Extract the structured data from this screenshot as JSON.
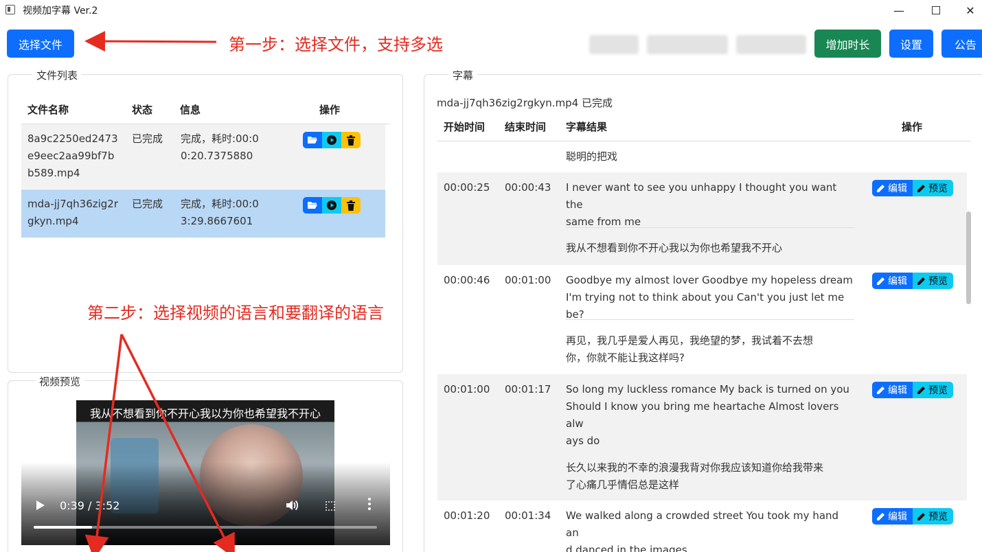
{
  "window": {
    "title": "视频加字幕 Ver.2",
    "minimize": "—",
    "close": "✕"
  },
  "toolbar": {
    "select_files": "选择文件",
    "add_time": "增加时长",
    "settings": "设置",
    "notice": "公告"
  },
  "annotations": {
    "step1": "第一步：选择文件，支持多选",
    "step2": "第二步：选择视频的语言和要翻译的语言"
  },
  "file_list": {
    "legend": "文件列表",
    "columns": [
      "文件名称",
      "状态",
      "信息",
      "操作"
    ],
    "rows": [
      {
        "name_lines": [
          "8a9c2250ed2473",
          "e9eec2aa99bf7b",
          "b589.mp4"
        ],
        "status": "已完成",
        "info_lines": [
          "完成，耗时:00:0",
          "0:20.7375880"
        ],
        "selected": false
      },
      {
        "name_lines": [
          "mda-jj7qh36zig2r",
          "gkyn.mp4"
        ],
        "status": "已完成",
        "info_lines": [
          "完成，耗时:00:0",
          "3:29.8667601"
        ],
        "selected": true
      }
    ]
  },
  "video_preview": {
    "legend": "视频预览",
    "subtitle": "我从不想看到你不开心我以为你也希望我不开心",
    "time": "0:39 / 3:52",
    "progress": 0.17
  },
  "subtitles": {
    "legend": "字幕",
    "file_status": "mda-jj7qh36zig2rgkyn.mp4 已完成",
    "columns": [
      "开始时间",
      "结束时间",
      "字幕结果",
      "操作"
    ],
    "edit_label": "编辑",
    "preview_label": "预览",
    "partial_text": "聪明的把戏",
    "rows": [
      {
        "start": "00:00:25",
        "end": "00:00:43",
        "en_lines": [
          "I never want to see you unhappy I thought you want the",
          "same from me"
        ],
        "zh_lines": [
          "我从不想看到你不开心我以为你也希望我不开心"
        ]
      },
      {
        "start": "00:00:46",
        "end": "00:01:00",
        "en_lines": [
          "Goodbye my almost lover Goodbye my hopeless dream",
          "I'm trying not to think about you Can't you just let me be?"
        ],
        "zh_lines": [
          "再见，我几乎是爱人再见，我绝望的梦，我试着不去想",
          "你，你就不能让我这样吗?"
        ]
      },
      {
        "start": "00:01:00",
        "end": "00:01:17",
        "en_lines": [
          "So long my luckless romance My back is turned on you",
          "Should I know you bring me heartache Almost lovers alw",
          "ays do"
        ],
        "zh_lines": [
          "长久以来我的不幸的浪漫我背对你我应该知道你给我带来",
          "了心痛几乎情侣总是这样"
        ]
      },
      {
        "start": "00:01:20",
        "end": "00:01:34",
        "en_lines": [
          "We walked along a crowded street You took my hand an",
          "d danced in the images"
        ],
        "zh_lines": []
      }
    ]
  },
  "colors": {
    "primary": "#0d6efd",
    "success": "#198754",
    "info": "#0dcaf0",
    "warning": "#ffc107",
    "selected_row": "#b9d8f5",
    "alt_row": "#f2f2f2",
    "annotation": "#e52b20"
  }
}
